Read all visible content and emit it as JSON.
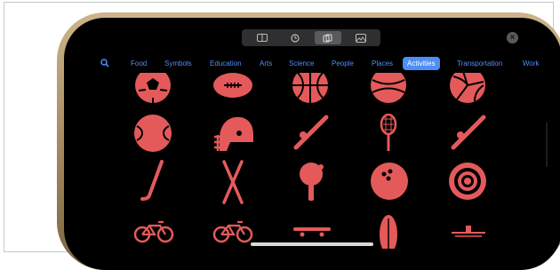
{
  "colors": {
    "accent": "#4d8ef7",
    "emoji": "#e45a5a",
    "screen": "#000000"
  },
  "topbar": {
    "tabs": [
      "keyboard-icon",
      "clock-icon",
      "activity-icon",
      "image-icon"
    ],
    "active": 2
  },
  "categories": [
    "Food",
    "Symbols",
    "Education",
    "Arts",
    "Science",
    "People",
    "Places",
    "Activities",
    "Transportation",
    "Work"
  ],
  "active_category": "Activities",
  "emoji_grid": [
    [
      "soccer-ball",
      "football",
      "basketball",
      "baseball",
      "volleyball"
    ],
    [
      "softball",
      "football-helmet",
      "cricket-bat",
      "tennis-racket",
      "cricket-bat"
    ],
    [
      "hockey-stick",
      "skis",
      "ping-pong",
      "bowling-ball",
      "target"
    ],
    [
      "bicycle",
      "bicycle",
      "skateboard",
      "surfboard",
      "ice-skate"
    ]
  ]
}
